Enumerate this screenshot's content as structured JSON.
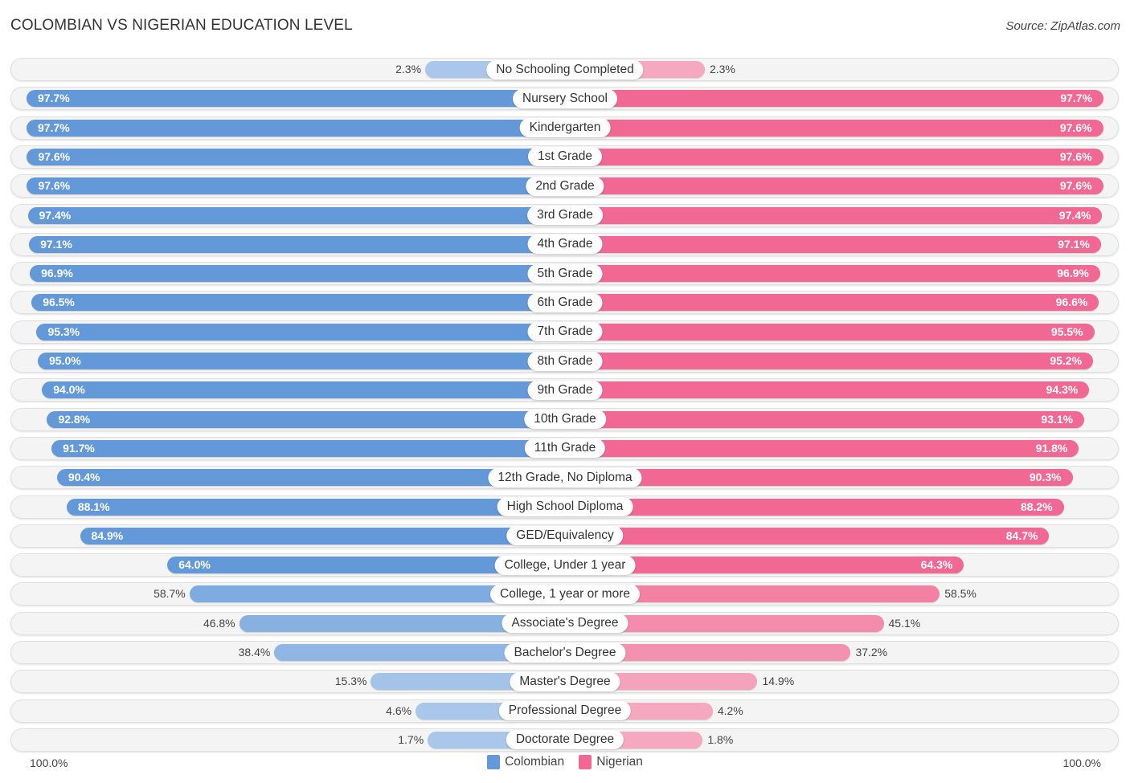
{
  "title": "COLOMBIAN VS NIGERIAN EDUCATION LEVEL",
  "source": "Source: ZipAtlas.com",
  "colors": {
    "colombian": "#6399d9",
    "colombian_light": "#a9c7ea",
    "nigerian": "#f06893",
    "nigerian_light": "#f5a8c0"
  },
  "axis": {
    "left_label": "100.0%",
    "right_label": "100.0%"
  },
  "legend": [
    {
      "name": "Colombian",
      "color": "#6399d9"
    },
    {
      "name": "Nigerian",
      "color": "#f06893"
    }
  ],
  "chart_data": {
    "type": "bar",
    "orientation": "horizontal-diverging",
    "title": "COLOMBIAN VS NIGERIAN EDUCATION LEVEL",
    "xlabel": "",
    "ylabel": "",
    "xlim": [
      0,
      100
    ],
    "unit": "%",
    "legend_position": "bottom-center",
    "categories": [
      "No Schooling Completed",
      "Nursery School",
      "Kindergarten",
      "1st Grade",
      "2nd Grade",
      "3rd Grade",
      "4th Grade",
      "5th Grade",
      "6th Grade",
      "7th Grade",
      "8th Grade",
      "9th Grade",
      "10th Grade",
      "11th Grade",
      "12th Grade, No Diploma",
      "High School Diploma",
      "GED/Equivalency",
      "College, Under 1 year",
      "College, 1 year or more",
      "Associate's Degree",
      "Bachelor's Degree",
      "Master's Degree",
      "Professional Degree",
      "Doctorate Degree"
    ],
    "series": [
      {
        "name": "Colombian",
        "side": "left",
        "values": [
          2.3,
          97.7,
          97.7,
          97.6,
          97.6,
          97.4,
          97.1,
          96.9,
          96.5,
          95.3,
          95.0,
          94.0,
          92.8,
          91.7,
          90.4,
          88.1,
          84.9,
          64.0,
          58.7,
          46.8,
          38.4,
          15.3,
          4.6,
          1.7
        ]
      },
      {
        "name": "Nigerian",
        "side": "right",
        "values": [
          2.3,
          97.7,
          97.6,
          97.6,
          97.6,
          97.4,
          97.1,
          96.9,
          96.6,
          95.5,
          95.2,
          94.3,
          93.1,
          91.8,
          90.3,
          88.2,
          84.7,
          64.3,
          58.5,
          45.1,
          37.2,
          14.9,
          4.2,
          1.8
        ]
      }
    ]
  }
}
